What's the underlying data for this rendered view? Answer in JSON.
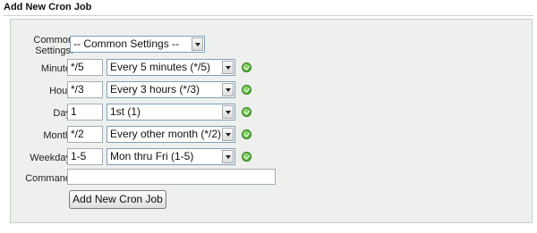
{
  "section": {
    "title": "Add New Cron Job"
  },
  "common": {
    "label_line1": "Common",
    "label_line2": "Settings:",
    "selected": "-- Common Settings --"
  },
  "rows": [
    {
      "label": "Minute:",
      "value": "*/5",
      "selected": "Every 5 minutes (*/5)"
    },
    {
      "label": "Hour:",
      "value": "*/3",
      "selected": "Every 3 hours (*/3)"
    },
    {
      "label": "Day:",
      "value": "1",
      "selected": "1st (1)"
    },
    {
      "label": "Month:",
      "value": "*/2",
      "selected": "Every other month (*/2)"
    },
    {
      "label": "Weekday:",
      "value": "1-5",
      "selected": "Mon thru Fri (1-5)"
    }
  ],
  "command": {
    "label": "Command:",
    "value": ""
  },
  "submit": {
    "label": "Add New Cron Job"
  },
  "icons": {
    "valid": "check-circle-icon",
    "dropdown": "chevron-down-icon"
  },
  "colors": {
    "panel_bg": "#edf0ed",
    "valid_green": "#3c9a22"
  }
}
